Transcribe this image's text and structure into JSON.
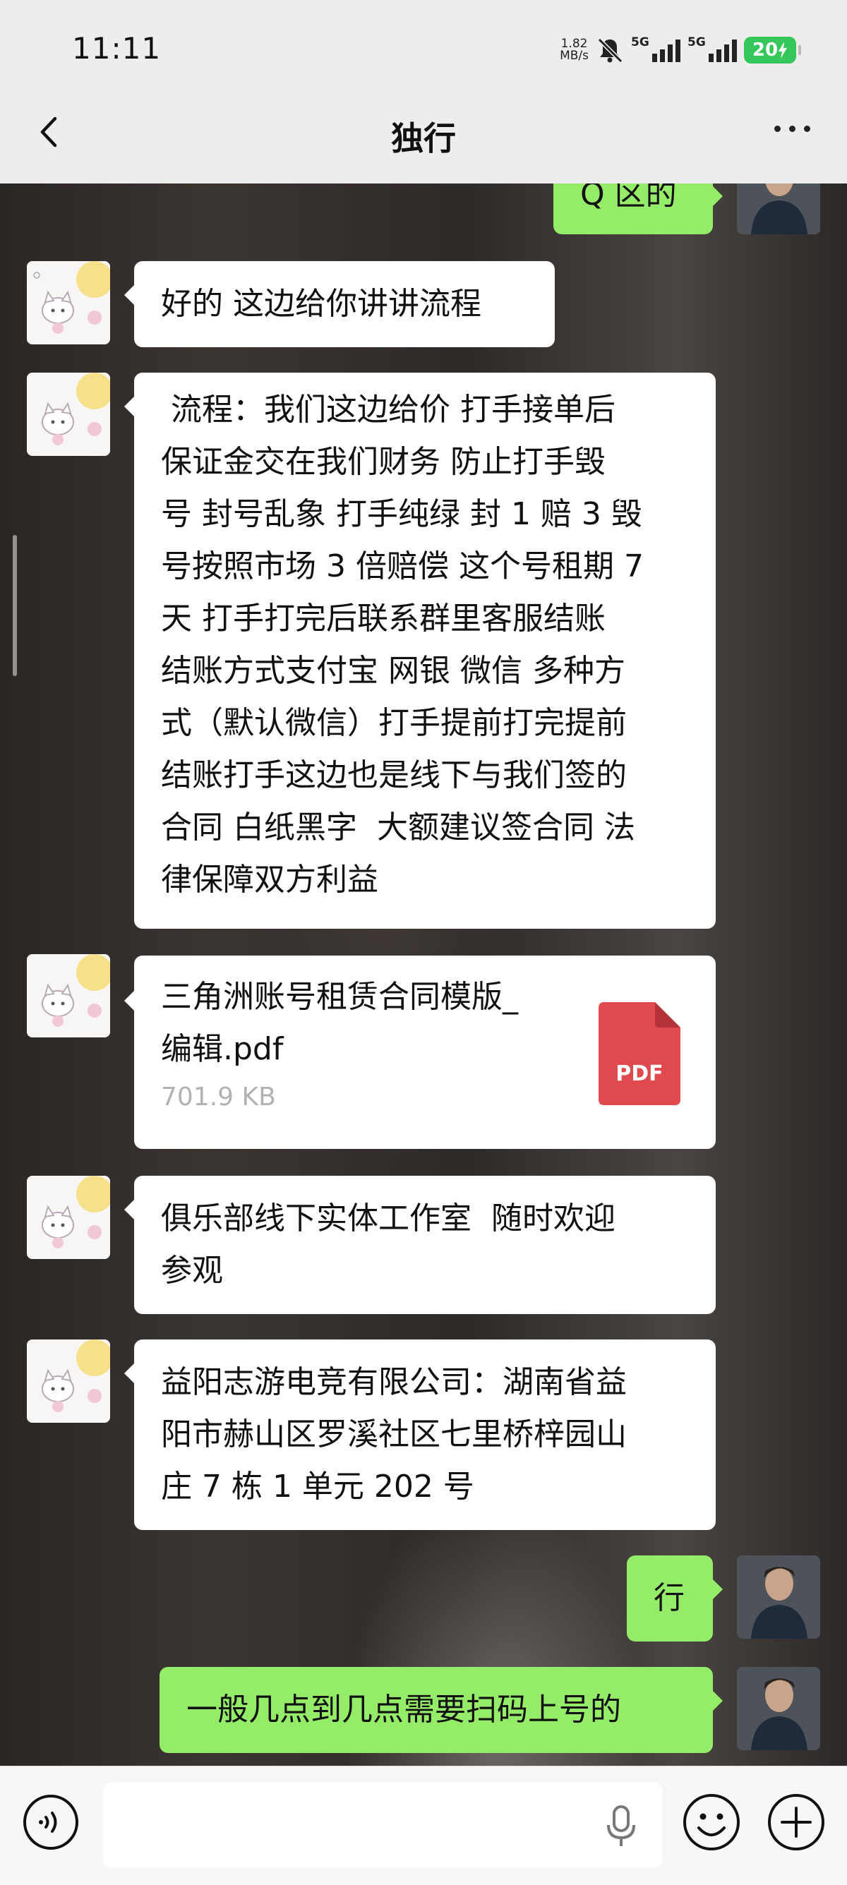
{
  "status_bar": {
    "time": "11:11",
    "net_speed_value": "1.82",
    "net_speed_unit": "MB/s",
    "signal_1_label": "5G",
    "signal_2_label": "5G",
    "battery": "20"
  },
  "nav": {
    "title": "独行"
  },
  "messages": [
    {
      "side": "right",
      "type": "text",
      "text": "Q 区的"
    },
    {
      "side": "left",
      "type": "text",
      "text": "好的 这边给你讲讲流程"
    },
    {
      "side": "left",
      "type": "text",
      "lines": [
        " 流程：我们这边给价 打手接单后",
        "保证金交在我们财务 防止打手毁",
        "号 封号乱象 打手纯绿 封 1 赔 3 毁",
        "号按照市场 3 倍赔偿 这个号租期 7",
        "天 打手打完后联系群里客服结账",
        "结账方式支付宝 网银 微信 多种方",
        "式（默认微信）打手提前打完提前",
        "结账打手这边也是线下与我们签的",
        "合同 白纸黑字  大额建议签合同 法",
        "律保障双方利益"
      ]
    },
    {
      "side": "left",
      "type": "file",
      "name_line1": "三角洲账号租赁合同模版_",
      "name_line2": "编辑.pdf",
      "size": "701.9 KB",
      "icon_label": "PDF"
    },
    {
      "side": "left",
      "type": "text",
      "lines": [
        "俱乐部线下实体工作室  随时欢迎",
        "参观"
      ]
    },
    {
      "side": "left",
      "type": "text",
      "lines": [
        "益阳志游电竞有限公司：湖南省益",
        "阳市赫山区罗溪社区七里桥梓园山",
        "庄 7 栋 1 单元 202 号"
      ]
    },
    {
      "side": "right",
      "type": "text",
      "text": "行"
    },
    {
      "side": "right",
      "type": "text",
      "text": "一般几点到几点需要扫码上号的"
    }
  ],
  "input": {
    "value": ""
  }
}
